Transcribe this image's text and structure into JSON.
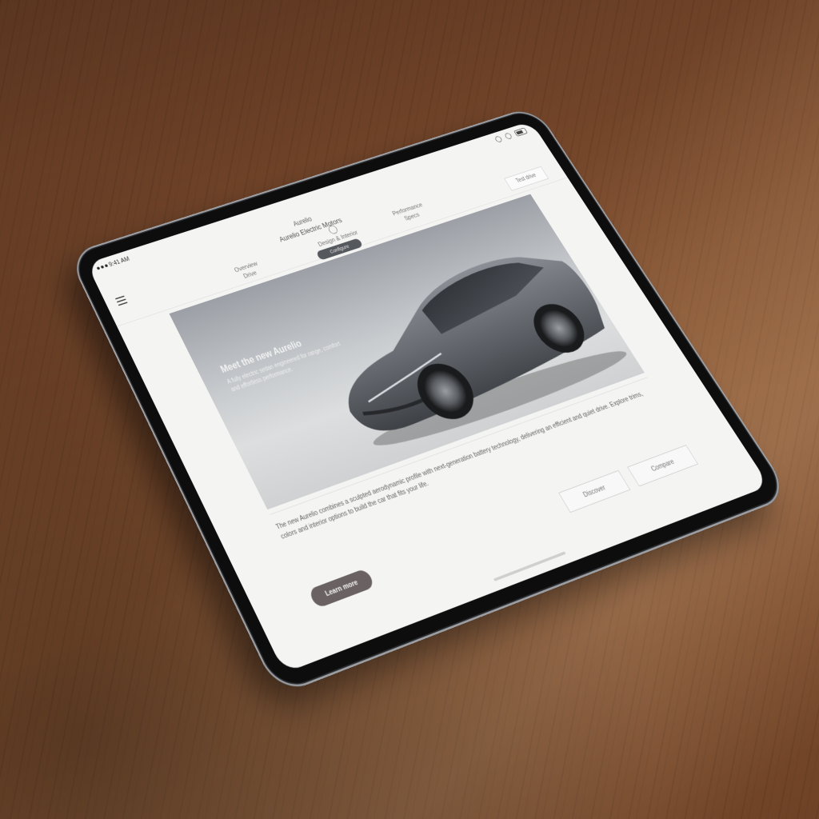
{
  "statusbar": {
    "time": "9:41 AM"
  },
  "header": {
    "brand": "Aurelio",
    "subtitle": "Aurelio Electric Motors",
    "nav": [
      {
        "label": "Overview",
        "sub": "Drive"
      },
      {
        "label": "Design & Interior"
      },
      {
        "label": "Performance",
        "sub": "Specs"
      }
    ],
    "nav_pill": "Configure",
    "top_button": "Test drive"
  },
  "hero": {
    "title": "Meet the new Aurelio",
    "subtitle": "A fully electric sedan engineered for range, comfort and effortless performance."
  },
  "body": {
    "paragraph": "The new Aurelio combines a sculpted aerodynamic profile with next-generation battery technology, delivering an efficient and quiet drive. Explore trims, colors and interior options to build the car that fits your life."
  },
  "actions": {
    "primary": "Learn more",
    "secondary_1": "Discover",
    "secondary_2": "Compare"
  }
}
